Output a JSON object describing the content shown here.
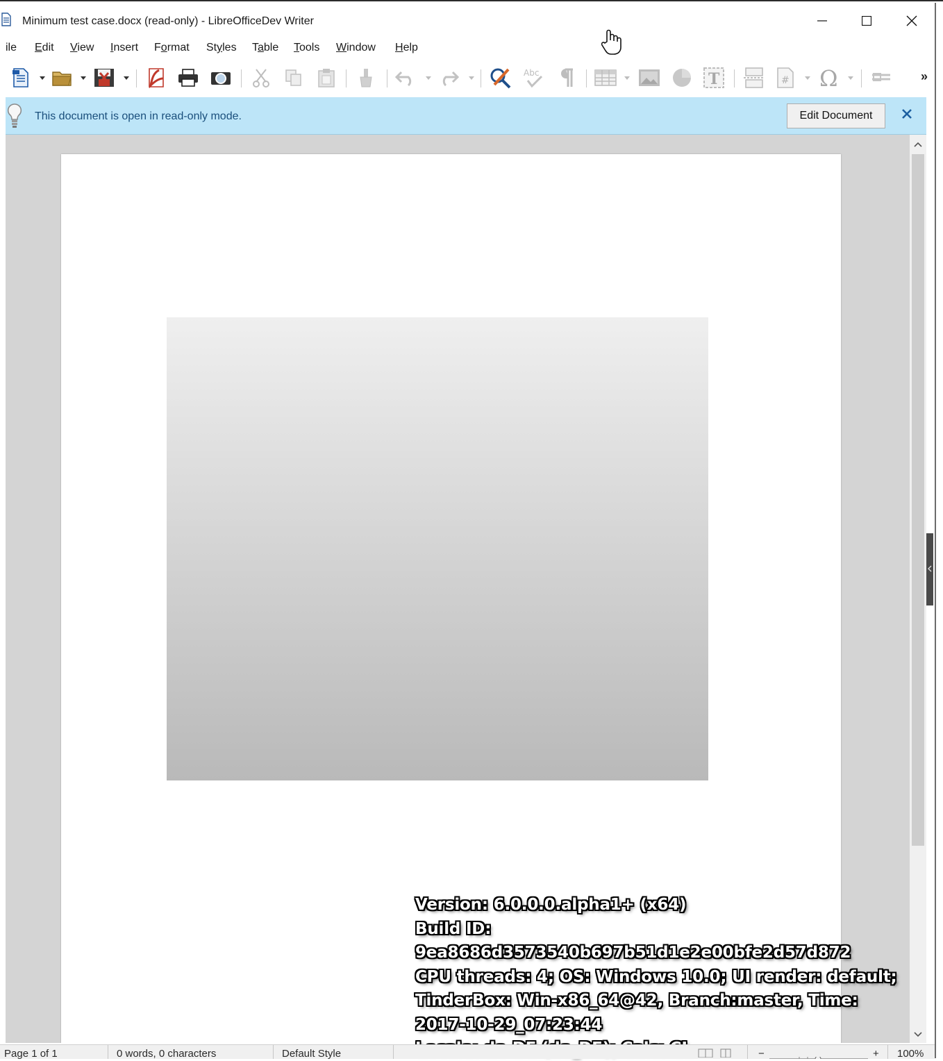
{
  "window": {
    "title": "Minimum test case.docx (read-only) - LibreOfficeDev Writer",
    "minimize_icon": "minimize-icon",
    "maximize_icon": "maximize-icon",
    "close_icon": "close-icon"
  },
  "menubar": {
    "items": [
      {
        "pre": "",
        "u": "",
        "post": "ile"
      },
      {
        "pre": "",
        "u": "E",
        "post": "dit"
      },
      {
        "pre": "",
        "u": "V",
        "post": "iew"
      },
      {
        "pre": "",
        "u": "I",
        "post": "nsert"
      },
      {
        "pre": "F",
        "u": "o",
        "post": "rmat"
      },
      {
        "pre": "St",
        "u": "y",
        "post": "les"
      },
      {
        "pre": "T",
        "u": "a",
        "post": "ble"
      },
      {
        "pre": "",
        "u": "T",
        "post": "ools"
      },
      {
        "pre": "",
        "u": "W",
        "post": "indow"
      },
      {
        "pre": "",
        "u": "H",
        "post": "elp"
      }
    ]
  },
  "toolbar": {
    "icons": [
      "new-document-icon",
      "open-folder-icon",
      "save-icon",
      "export-pdf-icon",
      "print-icon",
      "print-preview-icon",
      "cut-icon",
      "copy-icon",
      "paste-icon",
      "clone-formatting-icon",
      "undo-icon",
      "redo-icon",
      "find-replace-icon",
      "spelling-icon",
      "formatting-marks-icon",
      "insert-table-icon",
      "insert-image-icon",
      "insert-chart-icon",
      "insert-textbox-icon",
      "page-break-icon",
      "insert-field-icon",
      "special-character-icon",
      "insert-hyperlink-icon"
    ],
    "overflow": "»"
  },
  "infobar": {
    "message": "This document is open in read-only mode.",
    "edit_button": "Edit Document",
    "icon": "lightbulb-icon",
    "close": "✕"
  },
  "document": {
    "gradient_colors": {
      "top": "#efefef",
      "bottom": "#b9b9b9"
    }
  },
  "version_overlay": {
    "lines": [
      "Version: 6.0.0.0.alpha1+ (x64)",
      "Build ID:",
      "9ea8686d3573540b697b51d1e2e00bfe2d57d872",
      "CPU threads: 4; OS: Windows 10.0; UI render: default;",
      "TinderBox: Win-x86_64@42, Branch:master, Time:",
      "2017-10-29_07:23:44",
      "Locale: de-DE (de_DE); Calc: CL"
    ]
  },
  "statusbar": {
    "page": "Page 1 of 1",
    "words": "0 words, 0 characters",
    "style": "Default Style",
    "zoom": "100%",
    "zoom_minus": "−",
    "zoom_plus": "+"
  },
  "colors": {
    "infobar_bg": "#bde5f8",
    "infobar_text": "#1a4f7c",
    "infobar_close": "#1b5ea0",
    "doc_background": "#d4d4d4"
  }
}
